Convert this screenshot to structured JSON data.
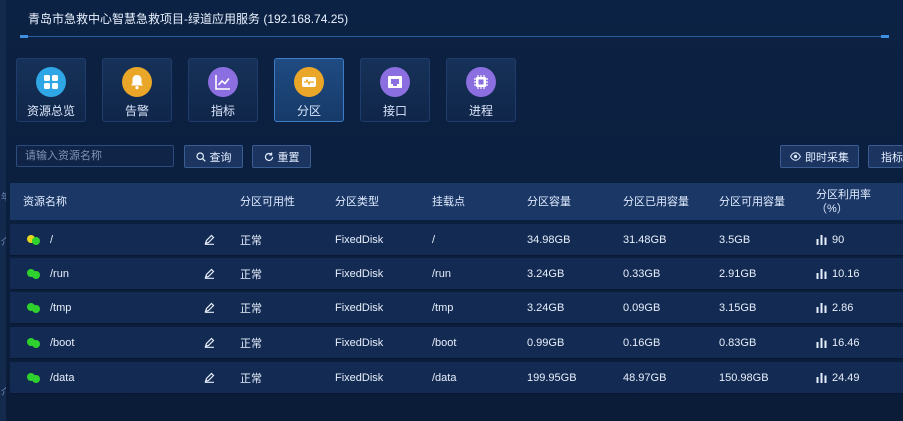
{
  "window": {
    "title": "青岛市急救中心智慧急救项目-绿道应用服务 (192.168.74.25)"
  },
  "left_strip": {
    "chars": [
      "年",
      "介",
      "介"
    ]
  },
  "tabs": [
    {
      "label": "资源总览",
      "icon": "grid-icon",
      "color": "#2fa6e6"
    },
    {
      "label": "告警",
      "icon": "bell-icon",
      "color": "#e9a628"
    },
    {
      "label": "指标",
      "icon": "line-chart-icon",
      "color": "#8b6ee0"
    },
    {
      "label": "分区",
      "icon": "partition-icon",
      "color": "#e9a628",
      "active": true
    },
    {
      "label": "接口",
      "icon": "interface-icon",
      "color": "#8b6ee0"
    },
    {
      "label": "进程",
      "icon": "chip-icon",
      "color": "#8b6ee0"
    }
  ],
  "toolbar": {
    "search_placeholder": "请输入资源名称",
    "query_label": "查询",
    "reset_label": "重置",
    "collect_label": "即时采集",
    "metrics_label": "指标"
  },
  "table": {
    "headers": [
      "资源名称",
      "分区可用性",
      "分区类型",
      "挂载点",
      "分区容量",
      "分区已用容量",
      "分区可用容量",
      "分区利用率（%）"
    ],
    "rows": [
      {
        "name": "/",
        "availability": "正常",
        "type": "FixedDisk",
        "mount": "/",
        "capacity": "34.98GB",
        "used": "31.48GB",
        "available": "3.5GB",
        "utilization": "90",
        "status_color": "#e6d51c"
      },
      {
        "name": "/run",
        "availability": "正常",
        "type": "FixedDisk",
        "mount": "/run",
        "capacity": "3.24GB",
        "used": "0.33GB",
        "available": "2.91GB",
        "utilization": "10.16",
        "status_color": "#2fd12f"
      },
      {
        "name": "/tmp",
        "availability": "正常",
        "type": "FixedDisk",
        "mount": "/tmp",
        "capacity": "3.24GB",
        "used": "0.09GB",
        "available": "3.15GB",
        "utilization": "2.86",
        "status_color": "#2fd12f"
      },
      {
        "name": "/boot",
        "availability": "正常",
        "type": "FixedDisk",
        "mount": "/boot",
        "capacity": "0.99GB",
        "used": "0.16GB",
        "available": "0.83GB",
        "utilization": "16.46",
        "status_color": "#2fd12f"
      },
      {
        "name": "/data",
        "availability": "正常",
        "type": "FixedDisk",
        "mount": "/data",
        "capacity": "199.95GB",
        "used": "48.97GB",
        "available": "150.98GB",
        "utilization": "24.49",
        "status_color": "#2fd12f"
      }
    ]
  }
}
